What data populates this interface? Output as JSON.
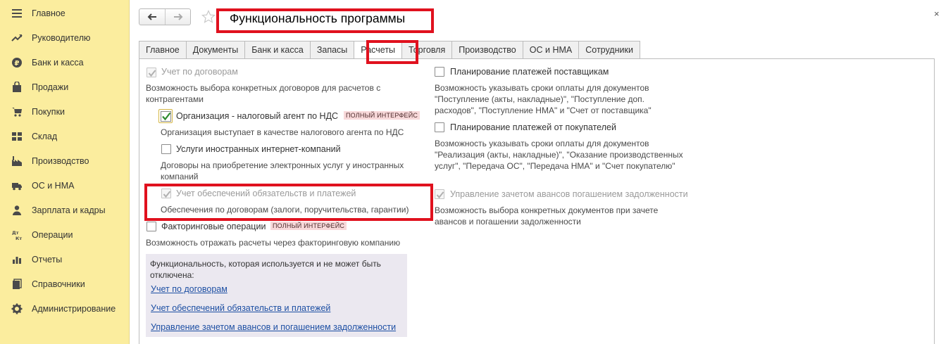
{
  "sidebar": {
    "items": [
      {
        "label": "Главное",
        "icon": "menu-icon"
      },
      {
        "label": "Руководителю",
        "icon": "trend-icon"
      },
      {
        "label": "Банк и касса",
        "icon": "ruble-icon"
      },
      {
        "label": "Продажи",
        "icon": "bag-icon"
      },
      {
        "label": "Покупки",
        "icon": "cart-icon"
      },
      {
        "label": "Склад",
        "icon": "warehouse-icon"
      },
      {
        "label": "Производство",
        "icon": "factory-icon"
      },
      {
        "label": "ОС и НМА",
        "icon": "truck-icon"
      },
      {
        "label": "Зарплата и кадры",
        "icon": "person-icon"
      },
      {
        "label": "Операции",
        "icon": "dt-kt-icon"
      },
      {
        "label": "Отчеты",
        "icon": "bar-chart-icon"
      },
      {
        "label": "Справочники",
        "icon": "books-icon"
      },
      {
        "label": "Администрирование",
        "icon": "gear-icon"
      }
    ]
  },
  "header": {
    "title": "Функциональность программы",
    "close": "×"
  },
  "tabs": [
    "Главное",
    "Документы",
    "Банк и касса",
    "Запасы",
    "Расчеты",
    "Торговля",
    "Производство",
    "ОС и НМА",
    "Сотрудники"
  ],
  "active_tab": "Расчеты",
  "left": {
    "contracts": {
      "label": "Учет по договорам",
      "checked": true,
      "disabled": true,
      "desc": "Возможность выбора конкретных договоров для расчетов с контрагентами"
    },
    "tax_agent": {
      "label": "Организация - налоговый агент по НДС",
      "badge": "ПОЛНЫЙ ИНТЕРФЕЙС",
      "checked": true,
      "desc": "Организация выступает в качестве налогового агента по НДС"
    },
    "foreign_services": {
      "label": "Услуги иностранных интернет-компаний",
      "checked": false,
      "desc": "Договоры на приобретение электронных услуг у иностранных компаний"
    },
    "guarantees": {
      "label": "Учет обеспечений обязательств и платежей",
      "checked": true,
      "disabled": true,
      "desc": "Обеспечения по договорам (залоги, поручительства, гарантии)"
    },
    "factoring": {
      "label": "Факторинговые операции",
      "badge": "ПОЛНЫЙ ИНТЕРФЕЙС",
      "checked": false,
      "desc": "Возможность отражать расчеты через факторинговую компанию"
    }
  },
  "right": {
    "supplier_planning": {
      "label": "Планирование платежей поставщикам",
      "checked": false,
      "desc": "Возможность указывать сроки оплаты для документов \"Поступление (акты, накладные)\", \"Поступление доп. расходов\", \"Поступление НМА\" и \"Счет от поставщика\""
    },
    "customer_planning": {
      "label": "Планирование платежей от покупателей",
      "checked": false,
      "desc": "Возможность указывать сроки оплаты для документов \"Реализация (акты, накладные)\", \"Оказание производственных услуг\", \"Передача ОС\", \"Передача НМА\" и \"Счет покупателю\""
    },
    "advance_offset": {
      "label": "Управление зачетом авансов погашением задолженности",
      "checked": true,
      "disabled": true,
      "desc": "Возможность выбора конкретных документов при зачете авансов и погашении задолженности"
    }
  },
  "info_box": {
    "text": "Функциональность, которая используется и не может быть отключена:",
    "links": [
      "Учет по договорам",
      "Учет обеспечений обязательств и платежей",
      "Управление зачетом авансов и погашением задолженности"
    ]
  },
  "colors": {
    "sidebar_bg": "#fbed9e",
    "highlight": "#e0111e",
    "link": "#1d4fa3",
    "badge_bg": "#f8d9da",
    "info_bg": "#ebe8f0"
  }
}
